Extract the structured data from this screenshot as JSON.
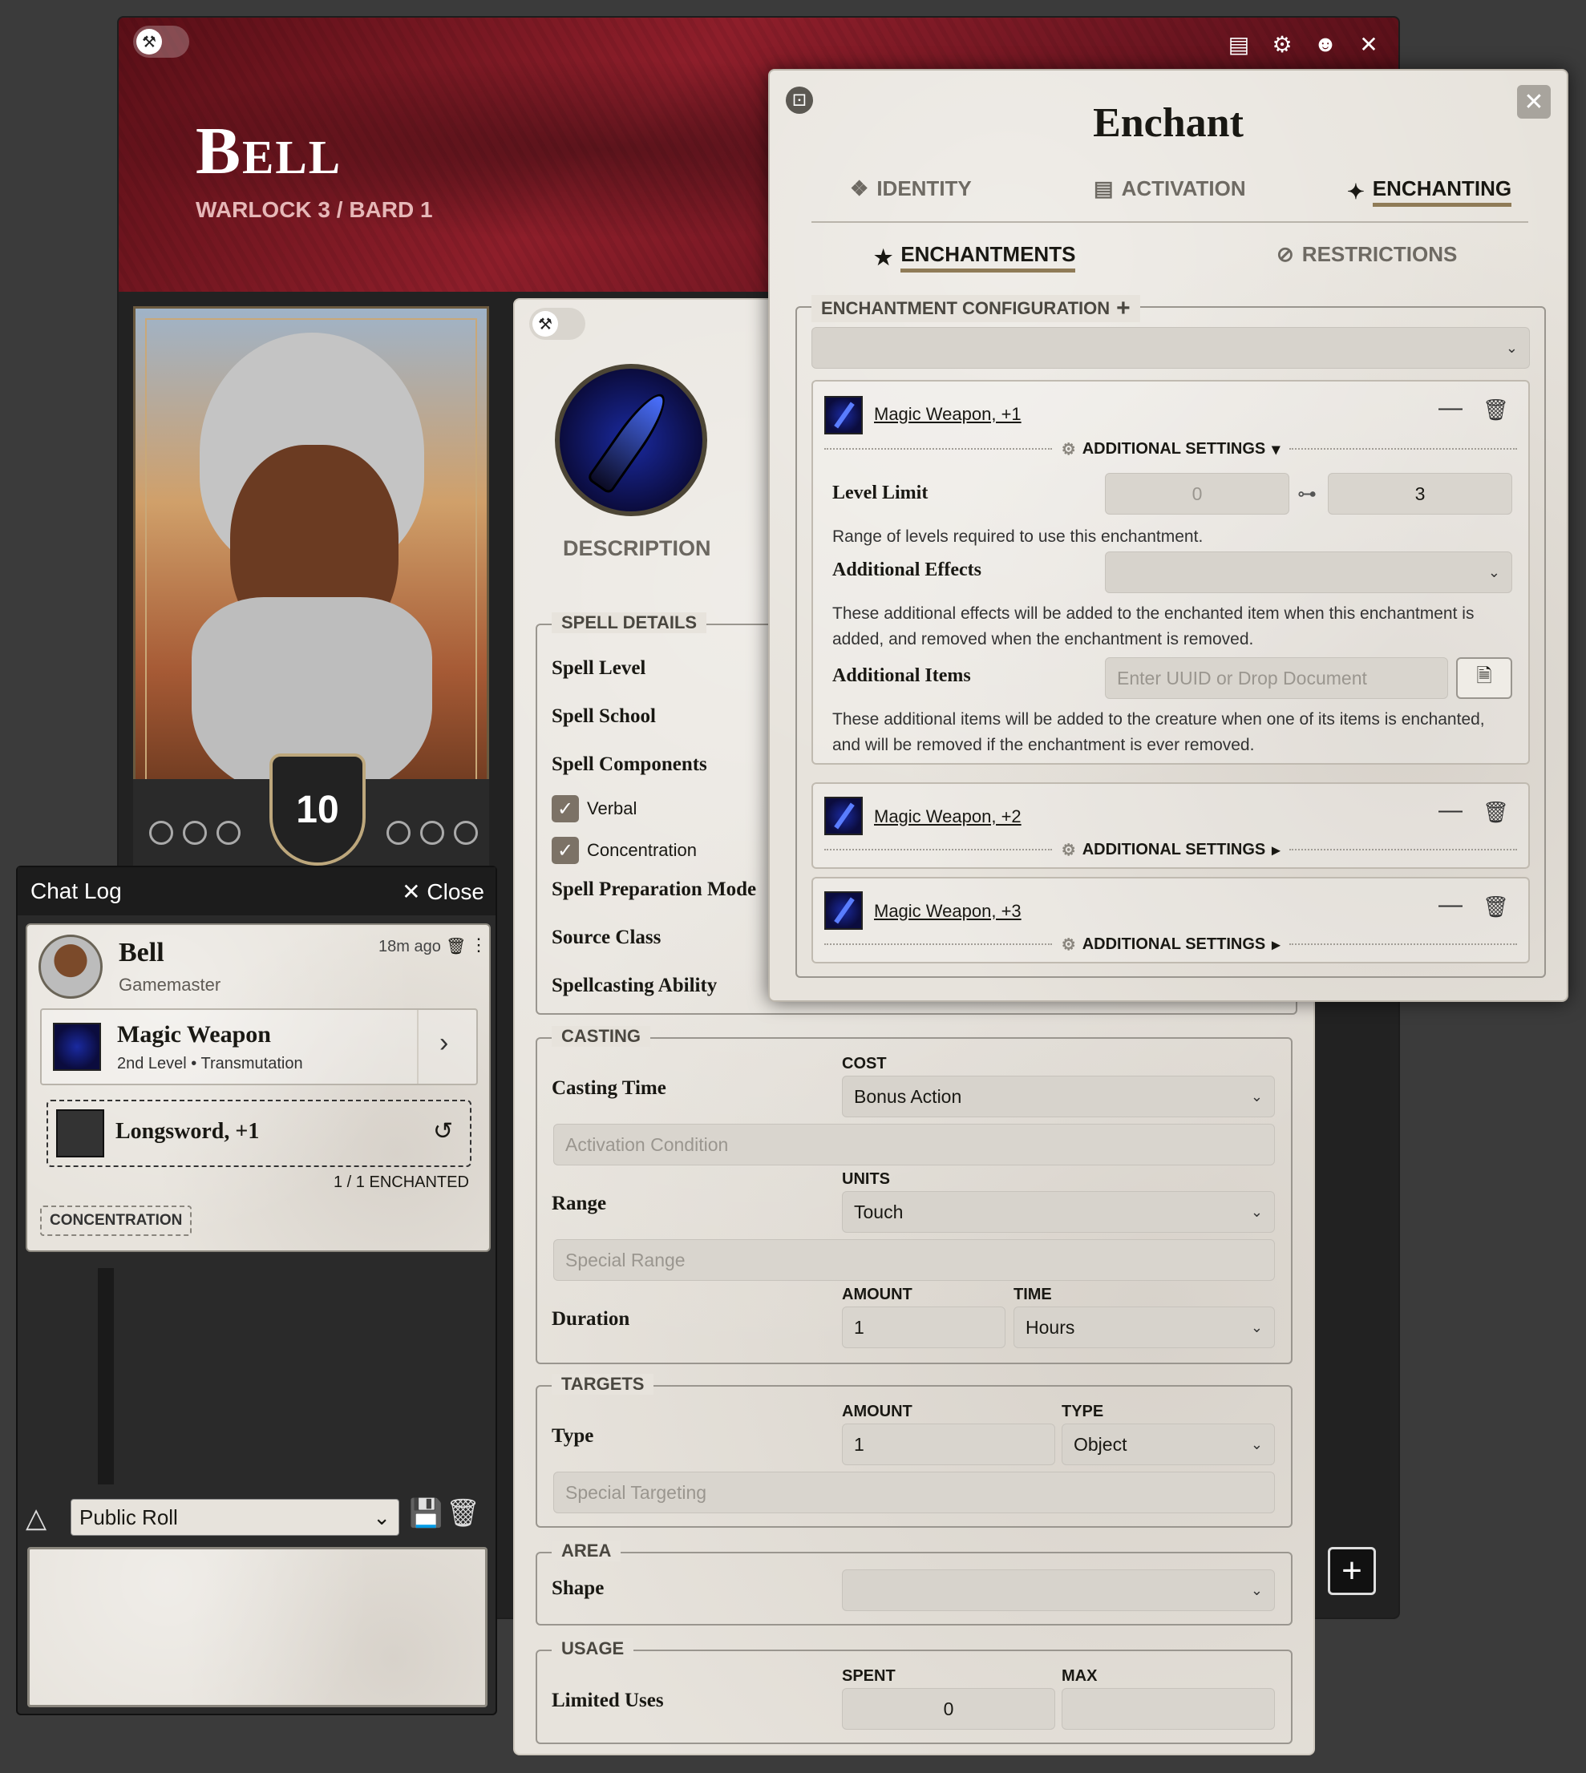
{
  "character": {
    "name": "Bell",
    "class": "WARLOCK 3 / BARD 1",
    "level": "10"
  },
  "header_icons": [
    "tokenizer-icon",
    "gear-icon",
    "user-icon",
    "close-icon"
  ],
  "item_sheet": {
    "description_label": "DESCRIPTION",
    "spell_details": {
      "legend": "SPELL DETAILS",
      "spell_level": "Spell Level",
      "spell_school": "Spell School",
      "spell_components": "Spell Components",
      "verbal": "Verbal",
      "concentration": "Concentration",
      "preparation_mode": "Spell Preparation Mode",
      "source_class": "Source Class",
      "casting_ability": "Spellcasting Ability"
    },
    "casting": {
      "legend": "CASTING",
      "casting_time_label": "Casting Time",
      "cost_label": "COST",
      "cost_value": "Bonus Action",
      "activation_condition_placeholder": "Activation Condition",
      "range_label": "Range",
      "units_label": "UNITS",
      "units_value": "Touch",
      "special_range_placeholder": "Special Range",
      "duration_label": "Duration",
      "amount_label": "AMOUNT",
      "time_label": "TIME",
      "duration_amount": "1",
      "duration_time": "Hours"
    },
    "targets": {
      "legend": "TARGETS",
      "type_label": "Type",
      "amount_label": "AMOUNT",
      "type_col_label": "TYPE",
      "amount_value": "1",
      "type_value": "Object",
      "special_targeting_placeholder": "Special Targeting"
    },
    "area": {
      "legend": "AREA",
      "shape_label": "Shape",
      "shape_value": ""
    },
    "usage": {
      "legend": "USAGE",
      "limited_uses_label": "Limited Uses",
      "spent_label": "SPENT",
      "max_label": "MAX",
      "spent_value": "0",
      "max_value": ""
    }
  },
  "enchant_dialog": {
    "title": "Enchant",
    "tabs": [
      "IDENTITY",
      "ACTIVATION",
      "ENCHANTING"
    ],
    "active_tab": "ENCHANTING",
    "subtabs": [
      "ENCHANTMENTS",
      "RESTRICTIONS"
    ],
    "active_subtab": "ENCHANTMENTS",
    "config_legend": "ENCHANTMENT CONFIGURATION",
    "config_select_value": "",
    "additional_settings_label": "ADDITIONAL SETTINGS",
    "enchantments": [
      {
        "name": "Magic Weapon, +1",
        "expanded": true
      },
      {
        "name": "Magic Weapon, +2",
        "expanded": false
      },
      {
        "name": "Magic Weapon, +3",
        "expanded": false
      }
    ],
    "level_limit": {
      "label": "Level Limit",
      "min_placeholder": "0",
      "max_value": "3",
      "help": "Range of levels required to use this enchantment."
    },
    "additional_effects": {
      "label": "Additional Effects",
      "value": "",
      "help": "These additional effects will be added to the enchanted item when this enchantment is added, and removed when the enchantment is removed."
    },
    "additional_items": {
      "label": "Additional Items",
      "placeholder": "Enter UUID or Drop Document",
      "help": "These additional items will be added to the creature when one of its items is enchanted, and will be removed if the enchantment is ever removed."
    }
  },
  "chat_log": {
    "title": "Chat Log",
    "close_label": "Close",
    "message": {
      "speaker": "Bell",
      "role": "Gamemaster",
      "time": "18m ago",
      "spell_name": "Magic Weapon",
      "spell_subtitle": "2nd Level • Transmutation",
      "target_item": "Longsword, +1",
      "enchanted_count": "1 / 1 ENCHANTED",
      "tag": "CONCENTRATION"
    },
    "roll_mode": "Public Roll"
  }
}
